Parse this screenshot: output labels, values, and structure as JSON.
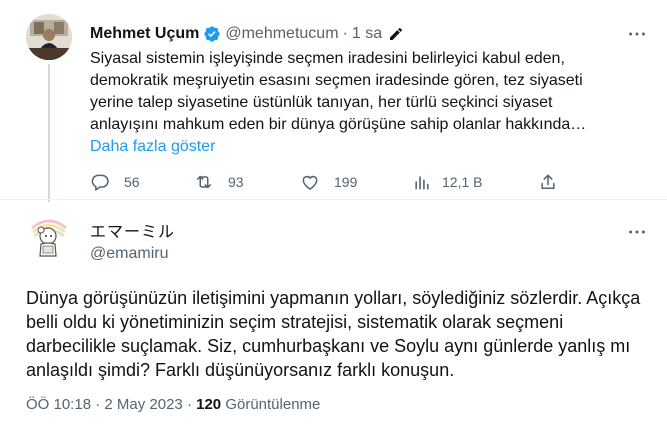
{
  "tweet": {
    "author_name": "Mehmet Uçum",
    "author_handle": "@mehmetucum",
    "separator": "·",
    "time": "1 sa",
    "text": "Siyasal sistemin işleyişinde seçmen iradesini belirleyici kabul eden, demokratik meşruiyetin esasını seçmen iradesinde gören, tez siyaseti yerine talep siyasetine üstünlük tanıyan, her türlü seçkinci siyaset anlayışını mahkum eden bir dünya görüşüne sahip olanlar hakkında…",
    "show_more": "Daha fazla göster",
    "replies": "56",
    "retweets": "93",
    "likes": "199",
    "views": "12,1 B"
  },
  "reply": {
    "author_name": "エマーミル",
    "author_handle": "@emamiru",
    "text": "Dünya görüşünüzün iletişimini yapmanın yolları, söylediğiniz sözlerdir. Açıkça belli oldu ki yönetiminizin seçim stratejisi, sistematik olarak seçmeni darbecilikle suçlamak. Siz, cumhurbaşkanı ve Soylu aynı günlerde yanlış mı anlaşıldı şimdi? Farklı düşünüyorsanız farklı konuşun.",
    "time": "ÖÖ 10:18",
    "separator": "·",
    "date": "2 May 2023",
    "views_count": "120",
    "views_label": "Görüntülenme"
  },
  "icons": {
    "verified": "verified-badge-icon",
    "edit": "pen-icon",
    "more": "more-icon",
    "reply": "reply-icon",
    "retweet": "retweet-icon",
    "like": "heart-icon",
    "views": "analytics-icon",
    "share": "share-icon"
  },
  "colors": {
    "accent": "#1d9bf0",
    "secondary_text": "#536471",
    "primary_text": "#0f1419",
    "divider": "#eff3f4"
  }
}
